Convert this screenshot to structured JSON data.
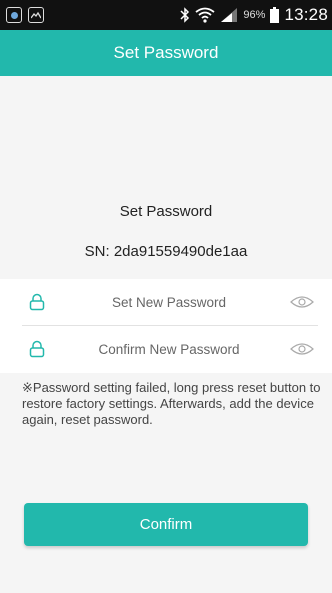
{
  "status_bar": {
    "battery": "96%",
    "time": "13:28",
    "icons": [
      "app-icon",
      "image-icon",
      "bluetooth-icon",
      "wifi-icon",
      "signal-icon",
      "battery-icon"
    ]
  },
  "header": {
    "title": "Set Password"
  },
  "info": {
    "title": "Set Password",
    "serial": "SN: 2da91559490de1aa"
  },
  "form": {
    "new_password": {
      "placeholder": "Set New Password",
      "value": ""
    },
    "confirm_password": {
      "placeholder": "Confirm New Password",
      "value": ""
    }
  },
  "warning": "※Password setting failed, long press reset button to restore factory settings. Afterwards, add the device again, reset password.",
  "confirm_button": "Confirm",
  "colors": {
    "accent": "#22b8ac",
    "background": "#f5f5f5",
    "status_bar": "#111111"
  }
}
